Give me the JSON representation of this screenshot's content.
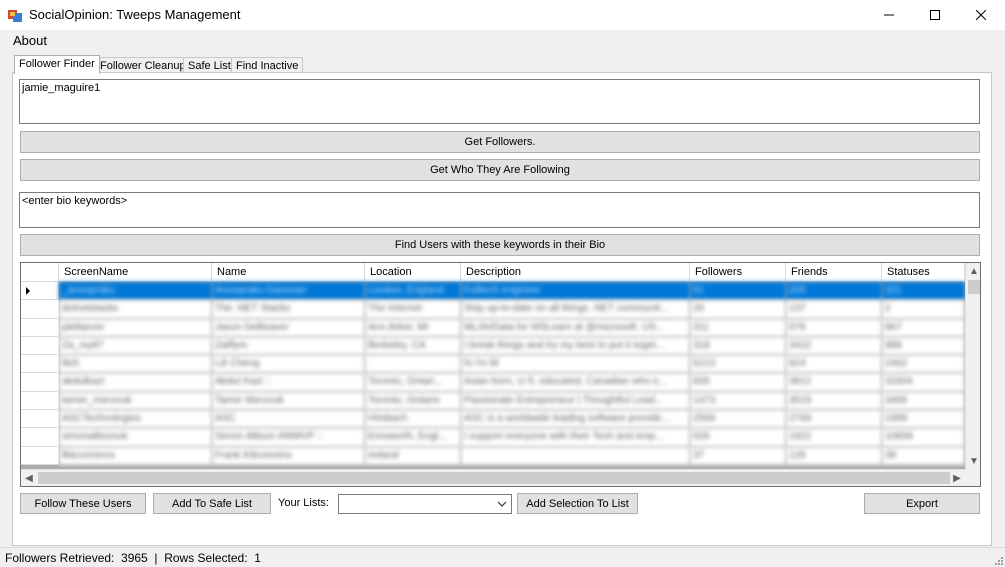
{
  "window": {
    "title": "SocialOpinion: Tweeps Management",
    "app_icon": "app-icon"
  },
  "menu": {
    "about": "About"
  },
  "tabs": [
    {
      "label": "Follower Finder",
      "active": true
    },
    {
      "label": "Follower Cleanup",
      "active": false
    },
    {
      "label": "Safe List",
      "active": false
    },
    {
      "label": "Find Inactive",
      "active": false
    }
  ],
  "finder": {
    "username_value": "jamie_maguire1",
    "get_followers_label": "Get Followers.",
    "get_following_label": "Get Who They Are Following",
    "bio_keywords_placeholder": "<enter bio keywords>",
    "find_users_label": "Find Users with these keywords in their Bio"
  },
  "grid": {
    "columns": [
      "ScreenName",
      "Name",
      "Location",
      "Description",
      "Followers",
      "Friends",
      "Statuses"
    ],
    "rows": [
      [
        "_anoopraku",
        "Anoopraku Ganesan",
        "London, England",
        "Fulltech engineer",
        "61",
        "200",
        "321"
      ],
      [
        "dotnetstacks",
        "The .NET Stacks",
        "The Internet",
        "Stay up-to-date on all things .NET communit...",
        "26",
        "137",
        "2"
      ],
      [
        "jdellaever",
        "Jason DeBeaver",
        "Ann Arbor, MI",
        "ML/AI/Data for MSLearn at @microsoft. US...",
        "311",
        "576",
        "867"
      ],
      [
        "Za_my87",
        "Zallfym",
        "Berkeley, CA",
        "I break things and try my best to put it toget...",
        "318",
        "3422",
        "989"
      ],
      [
        "lilch",
        "Lili Cheng",
        "",
        "hi i'm lili",
        "5213",
        "824",
        "2462"
      ],
      [
        "abdulkazi",
        "Abdul Kazi ::",
        "Toronto, Ontari...",
        "Asian born, U.S. educated, Canadian who e...",
        "606",
        "3812",
        "32604"
      ],
      [
        "tamer_merzouk",
        "Tamer Merzouk",
        "Toronto, Ontario",
        "Passionate Entrepreneur | Thoughtful Lead...",
        "1473",
        "3519",
        "3406"
      ],
      [
        "ASCTechnologies",
        "ASC",
        "Hösbach",
        "ASC is a worldwide leading software provide...",
        "2569",
        "2769",
        "1999"
      ],
      [
        "simonallisonuk",
        "Simon Allison #WMVP ::",
        "Emsworth, Engl...",
        "I support everyone with their Tech and emp...",
        "626",
        "1922",
        "10839"
      ],
      [
        "fkkconninns",
        "Frank Kikconnins",
        "Ireland",
        "",
        "37",
        "126",
        "39"
      ]
    ]
  },
  "actions": {
    "follow_label": "Follow These Users",
    "safe_list_label": "Add To Safe List",
    "your_lists_label": "Your Lists:",
    "your_lists_value": "",
    "add_selection_label": "Add Selection To List",
    "export_label": "Export"
  },
  "status": {
    "text": "Followers Retrieved:  3965  |  Rows Selected:  1"
  },
  "colors": {
    "selection": "#0078d7",
    "button_face": "#e1e1e1",
    "window_bg": "#f0f0f0"
  }
}
